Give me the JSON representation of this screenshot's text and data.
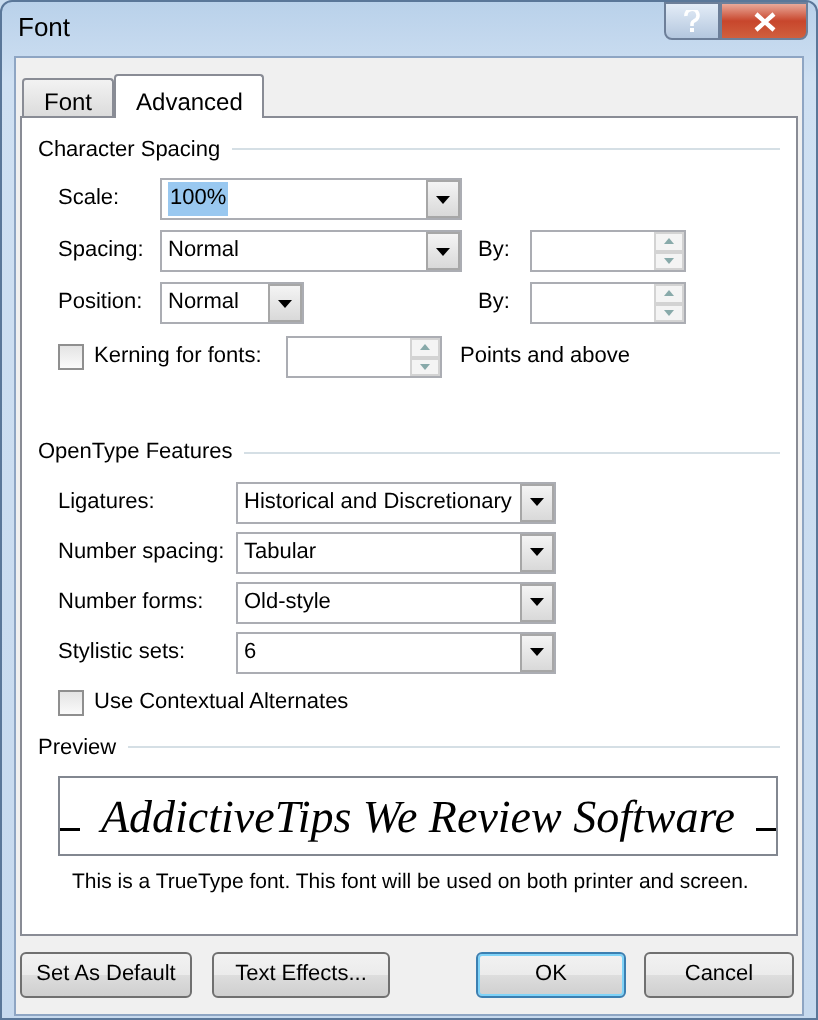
{
  "window": {
    "title": "Font"
  },
  "tabs": [
    {
      "label": "Font",
      "selected": false
    },
    {
      "label": "Advanced",
      "selected": true
    }
  ],
  "character_spacing": {
    "title": "Character Spacing",
    "rows": [
      {
        "kind": "combo",
        "label": "Scale:",
        "value": "100%",
        "value_selected": true
      },
      {
        "kind": "combo",
        "label": "Spacing:",
        "value": "Normal",
        "value_selected": false,
        "by_label": "By:"
      },
      {
        "kind": "short_combo",
        "label": "Position:",
        "value": "Normal",
        "value_selected": false,
        "by_label": "By:"
      },
      {
        "kind": "check",
        "label": "Kerning for fonts:",
        "checked": false,
        "suffix": "Points and above"
      }
    ]
  },
  "opentype_features": {
    "title": "OpenType Features",
    "rows": [
      {
        "label": "Ligatures:",
        "value": "Historical and Discretionary"
      },
      {
        "label": "Number spacing:",
        "value": "Tabular"
      },
      {
        "label": "Number forms:",
        "value": "Old-style"
      },
      {
        "label": "Stylistic sets:",
        "value": "6"
      }
    ],
    "checkbox": {
      "label": "Use Contextual Alternates",
      "checked": false
    }
  },
  "preview": {
    "title": "Preview",
    "sample": "AddictiveTips We Review Software",
    "note": "This is a TrueType font. This font will be used on both printer and screen."
  },
  "buttons": [
    {
      "label": "Set As Default",
      "default": false
    },
    {
      "label": "Text Effects...",
      "default": false
    },
    {
      "label": "OK",
      "default": true
    },
    {
      "label": "Cancel",
      "default": false
    }
  ]
}
